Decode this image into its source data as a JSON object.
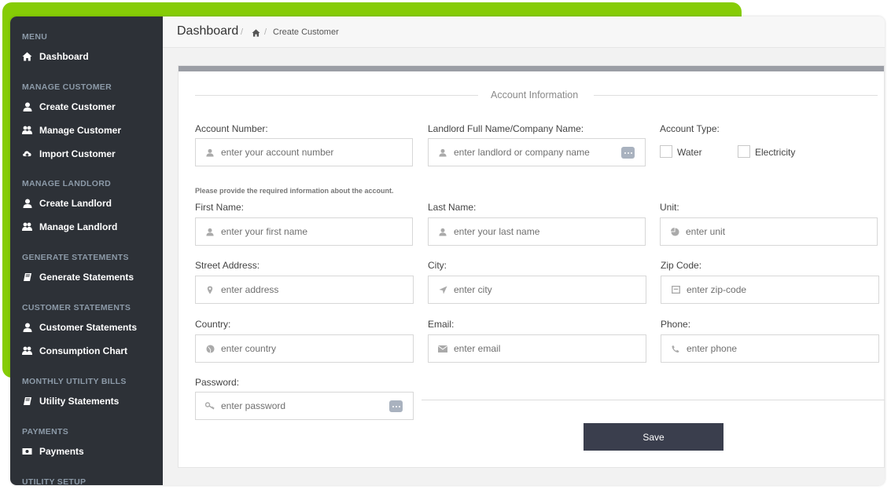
{
  "sidebar": {
    "sections": [
      {
        "title": "MENU",
        "items": [
          {
            "label": "Dashboard",
            "icon": "home-icon"
          }
        ]
      },
      {
        "title": "MANAGE CUSTOMER",
        "items": [
          {
            "label": "Create Customer",
            "icon": "user-icon"
          },
          {
            "label": "Manage Customer",
            "icon": "users-icon"
          },
          {
            "label": "Import Customer",
            "icon": "cloud-upload-icon"
          }
        ]
      },
      {
        "title": "MANAGE LANDLORD",
        "items": [
          {
            "label": "Create Landlord",
            "icon": "user-icon"
          },
          {
            "label": "Manage Landlord",
            "icon": "users-icon"
          }
        ]
      },
      {
        "title": "GENERATE STATEMENTS",
        "items": [
          {
            "label": "Generate Statements",
            "icon": "book-icon"
          }
        ]
      },
      {
        "title": "CUSTOMER STATEMENTS",
        "items": [
          {
            "label": "Customer Statements",
            "icon": "user-icon"
          },
          {
            "label": "Consumption Chart",
            "icon": "users-icon"
          }
        ]
      },
      {
        "title": "MONTHLY UTILITY BILLS",
        "items": [
          {
            "label": "Utility Statements",
            "icon": "book-icon"
          }
        ]
      },
      {
        "title": "PAYMENTS",
        "items": [
          {
            "label": "Payments",
            "icon": "money-icon"
          }
        ]
      },
      {
        "title": "UTILITY SETUP",
        "items": []
      }
    ]
  },
  "header": {
    "title": "Dashboard",
    "breadcrumb_current": "Create Customer"
  },
  "form": {
    "legend": "Account Information",
    "account_number": {
      "label": "Account Number:",
      "placeholder": "enter your account number"
    },
    "landlord": {
      "label": "Landlord Full Name/Company Name:",
      "placeholder": "enter landlord or company name"
    },
    "account_type": {
      "label": "Account Type:",
      "options": [
        "Water",
        "Electricity"
      ]
    },
    "note": "Please provide the required information about the account.",
    "first_name": {
      "label": "First Name:",
      "placeholder": "enter your first name"
    },
    "last_name": {
      "label": "Last Name:",
      "placeholder": "enter your last name"
    },
    "unit": {
      "label": "Unit:",
      "placeholder": "enter unit"
    },
    "street": {
      "label": "Street Address:",
      "placeholder": "enter address"
    },
    "city": {
      "label": "City:",
      "placeholder": "enter city"
    },
    "zip": {
      "label": "Zip Code:",
      "placeholder": "enter zip-code"
    },
    "country": {
      "label": "Country:",
      "placeholder": "enter country"
    },
    "email": {
      "label": "Email:",
      "placeholder": "enter email"
    },
    "phone": {
      "label": "Phone:",
      "placeholder": "enter phone"
    },
    "password": {
      "label": "Password:",
      "placeholder": "enter password"
    },
    "save_label": "Save"
  },
  "colors": {
    "accent_green": "#86cc06",
    "sidebar_bg": "#2d3137",
    "button_bg": "#3a3e4d"
  }
}
